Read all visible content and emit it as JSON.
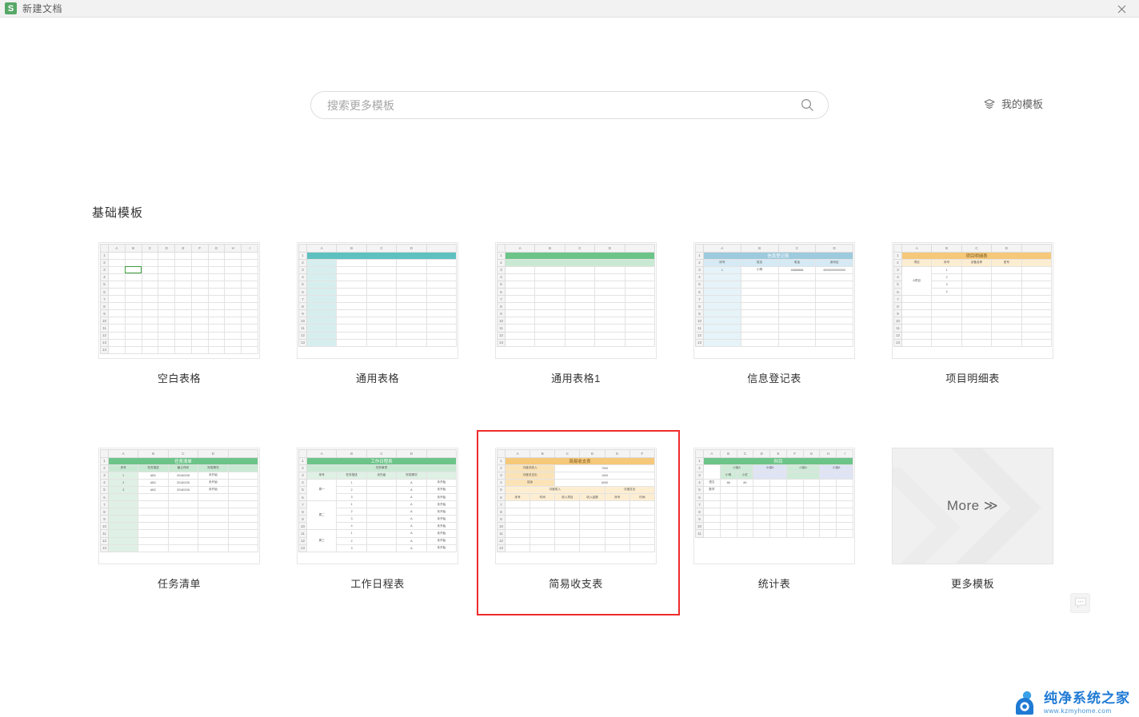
{
  "titlebar": {
    "logo_text": "S",
    "logo_icon": "wps-spreadsheet-logo-icon",
    "document_title": "新建文档",
    "close_icon": "close-icon"
  },
  "search": {
    "placeholder": "搜索更多模板",
    "value": "",
    "icon": "search-icon"
  },
  "my_templates": {
    "label": "我的模板",
    "icon": "my-templates-icon"
  },
  "section": {
    "title": "基础模板"
  },
  "more_card": {
    "label": "More ≫"
  },
  "feedback": {
    "icon": "feedback-bubble-icon"
  },
  "watermark": {
    "name": "纯净系统之家",
    "url": "www.kzmyhome.com"
  },
  "templates": [
    {
      "id": "blank-sheet",
      "label": "空白表格",
      "selected": false,
      "columns": [
        "A",
        "B",
        "C",
        "D",
        "E",
        "F",
        "G",
        "H",
        "I"
      ],
      "rows": [
        "1",
        "2",
        "3",
        "4",
        "5",
        "6",
        "7",
        "8",
        "9",
        "10",
        "11",
        "12",
        "13",
        "14"
      ],
      "selected_cell": "B3"
    },
    {
      "id": "general-sheet",
      "label": "通用表格",
      "selected": false,
      "columns": [
        "A",
        "B",
        "C",
        "D",
        ""
      ],
      "rows": [
        "1",
        "2",
        "3",
        "4",
        "5",
        "6",
        "7",
        "8",
        "9",
        "10",
        "11",
        "12",
        "13"
      ],
      "accent": "#5ec1c0"
    },
    {
      "id": "general-sheet-1",
      "label": "通用表格1",
      "selected": false,
      "columns": [
        "A",
        "B",
        "C",
        "D",
        ""
      ],
      "rows": [
        "1",
        "2",
        "3",
        "4",
        "5",
        "6",
        "7",
        "8",
        "9",
        "10",
        "11",
        "12",
        "13"
      ],
      "accent": "#6cc489"
    },
    {
      "id": "info-register",
      "label": "信息登记表",
      "selected": false,
      "columns": [
        "A",
        "B",
        "C",
        "D"
      ],
      "rows": [
        "1",
        "2",
        "3",
        "4",
        "5",
        "6",
        "7",
        "8",
        "9",
        "10",
        "11",
        "12",
        "13"
      ],
      "accent": "#9ecadd",
      "title_row": "信息登记表",
      "headers": [
        "序号",
        "姓名",
        "电话",
        "身份证"
      ],
      "data": [
        [
          "1",
          "小明",
          "18888888",
          "40000000000000"
        ]
      ]
    },
    {
      "id": "project-detail",
      "label": "项目明细表",
      "selected": false,
      "columns": [
        "A",
        "B",
        "C",
        "D",
        ""
      ],
      "rows": [
        "1",
        "2",
        "3",
        "4",
        "5",
        "6",
        "7",
        "8",
        "9",
        "10",
        "11",
        "12",
        "13"
      ],
      "accent": "#f5c87a",
      "title_row": "项目明细表",
      "headers": [
        "项目",
        "序号",
        "设备名称",
        "型号"
      ],
      "group_label": "A项目",
      "data": [
        [
          "1"
        ],
        [
          "2"
        ],
        [
          "3"
        ],
        [
          "4"
        ]
      ]
    },
    {
      "id": "task-list",
      "label": "任务清单",
      "selected": false,
      "columns": [
        "A",
        "B",
        "C",
        "D",
        ""
      ],
      "rows": [
        "1",
        "2",
        "3",
        "4",
        "5",
        "6",
        "7",
        "8",
        "9",
        "10",
        "11",
        "12",
        "13"
      ],
      "accent": "#6cc489",
      "title_row": "任务清单",
      "headers": [
        "序号",
        "任务描述",
        "截止时间",
        "完成情况"
      ],
      "data": [
        [
          "1",
          "ABC",
          "2018/2/28",
          "未开始"
        ],
        [
          "2",
          "ABC",
          "2018/2/28",
          "未开始"
        ],
        [
          "3",
          "ABC",
          "2018/2/28",
          "未开始"
        ]
      ]
    },
    {
      "id": "work-schedule",
      "label": "工作日程表",
      "selected": false,
      "columns": [
        "A",
        "B",
        "C",
        "D",
        ""
      ],
      "rows": [
        "1",
        "2",
        "3",
        "4",
        "5",
        "6",
        "7",
        "8",
        "9",
        "10",
        "11",
        "12",
        "13"
      ],
      "accent": "#6cc489",
      "title_row": "工作日程表",
      "group_header": "任务事项",
      "headers": [
        "序号",
        "任务描述",
        "优先级",
        "完成情况"
      ],
      "days": [
        "周一",
        "周二",
        "周三"
      ],
      "priority": "A",
      "status": "未开始"
    },
    {
      "id": "simple-income-expense",
      "label": "简易收支表",
      "selected": true,
      "columns": [
        "A",
        "B",
        "C",
        "D",
        "E",
        "F"
      ],
      "rows": [
        "1",
        "2",
        "3",
        "4",
        "5",
        "6",
        "7",
        "8",
        "9",
        "10",
        "11",
        "12",
        "13"
      ],
      "accent": "#f5c87a",
      "title_row": "简易收支表",
      "summary": [
        {
          "label": "月度总收入",
          "value": "7000"
        },
        {
          "label": "月度总支出",
          "value": "1000"
        },
        {
          "label": "结余",
          "value": "6000"
        }
      ],
      "group_headers": [
        "月度收入",
        "月度支出"
      ],
      "headers": [
        "序号",
        "时间",
        "收入项目",
        "收入金额",
        "序号",
        "时间"
      ]
    },
    {
      "id": "statistics-sheet",
      "label": "统计表",
      "selected": false,
      "columns": [
        "A",
        "B",
        "C",
        "D",
        "E",
        "F",
        "G",
        "H",
        "I"
      ],
      "rows": [
        "1",
        "2",
        "3",
        "4",
        "5",
        "6",
        "7",
        "8",
        "9",
        "10",
        "11"
      ],
      "accent": "#6cc489",
      "title_row": "统计表",
      "subject_header": "科目",
      "groups": [
        "小组A",
        "小组A",
        "小组A",
        "小组A"
      ],
      "members": [
        "小明",
        "小红"
      ],
      "subjects": [
        "语文",
        "数学"
      ],
      "scores": [
        [
          "88",
          "89"
        ],
        [
          "",
          ""
        ]
      ]
    },
    {
      "id": "more-templates",
      "label": "更多模板",
      "selected": false,
      "is_more": true
    }
  ]
}
